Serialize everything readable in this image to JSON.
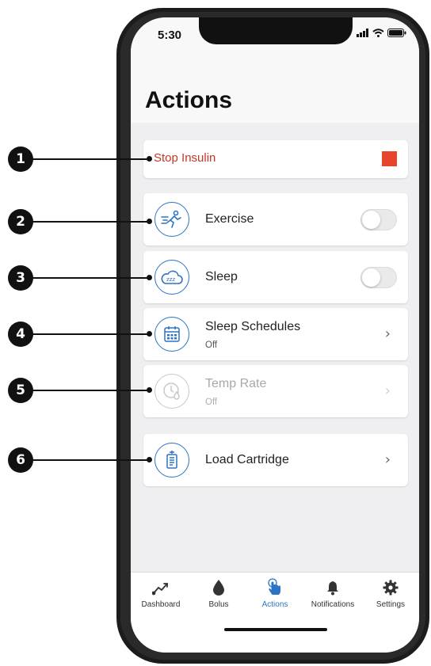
{
  "callouts": [
    "1",
    "2",
    "3",
    "4",
    "5",
    "6"
  ],
  "status": {
    "time": "5:30"
  },
  "header": {
    "title": "Actions"
  },
  "stop_insulin": {
    "label": "Stop Insulin"
  },
  "rows": {
    "exercise": {
      "label": "Exercise",
      "toggle": "off"
    },
    "sleep": {
      "label": "Sleep",
      "toggle": "off",
      "icon_text": "zzz"
    },
    "sleep_schedules": {
      "label": "Sleep Schedules",
      "value": "Off"
    },
    "temp_rate": {
      "label": "Temp Rate",
      "value": "Off",
      "state": "disabled"
    },
    "load_cartridge": {
      "label": "Load Cartridge"
    }
  },
  "tabs": [
    {
      "label": "Dashboard",
      "icon": "trend-icon"
    },
    {
      "label": "Bolus",
      "icon": "drop-icon"
    },
    {
      "label": "Actions",
      "icon": "touch-hand-icon",
      "active": true
    },
    {
      "label": "Notifications",
      "icon": "bell-icon"
    },
    {
      "label": "Settings",
      "icon": "gear-icon"
    }
  ],
  "colors": {
    "accent": "#2b73c5",
    "stop": "#e8432b",
    "stop_text": "#c0392b"
  }
}
